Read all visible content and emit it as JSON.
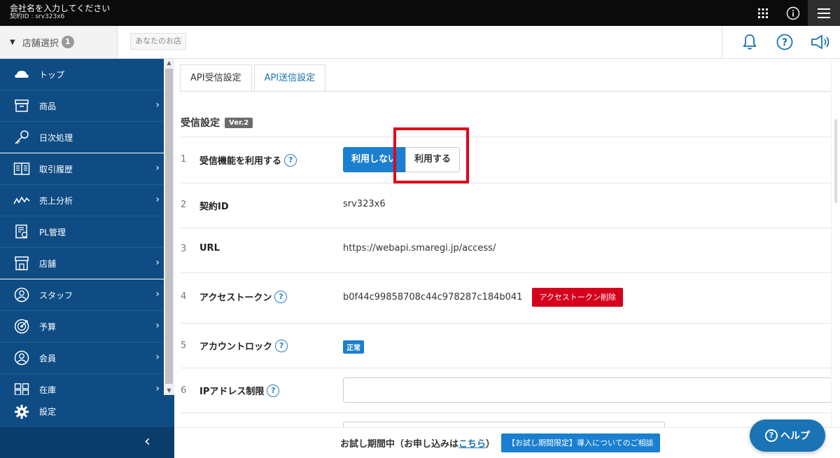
{
  "header": {
    "company_name": "会社名を入力してください",
    "contract_id": "契約ID : srv323x6",
    "icons": [
      "apps-grid-icon",
      "info-icon",
      "hamburger-menu-icon"
    ]
  },
  "storebar": {
    "store_select_label": "店舗選択",
    "store_count": "1",
    "store_chip": "あなたのお店",
    "icons": [
      "bell-icon",
      "help-circle-icon",
      "megaphone-icon"
    ]
  },
  "sidebar": {
    "items": [
      {
        "label": "トップ",
        "icon": "cloud-icon"
      },
      {
        "label": "商品",
        "icon": "box-icon"
      },
      {
        "label": "日次処理",
        "icon": "key-icon"
      },
      {
        "label": "取引履歴",
        "icon": "book-icon"
      },
      {
        "label": "売上分析",
        "icon": "chart-line-icon"
      },
      {
        "label": "PL管理",
        "icon": "pl-document-icon"
      },
      {
        "label": "店舗",
        "icon": "store-icon"
      },
      {
        "label": "スタッフ",
        "icon": "staff-icon"
      },
      {
        "label": "予算",
        "icon": "target-icon"
      },
      {
        "label": "会員",
        "icon": "member-icon"
      },
      {
        "label": "在庫",
        "icon": "inventory-icon"
      }
    ],
    "settings_label": "設定",
    "collapse_icon": "‹"
  },
  "tabs": [
    {
      "label": "API受信設定",
      "active": true
    },
    {
      "label": "API送信設定",
      "active": false
    }
  ],
  "section": {
    "title": "受信設定",
    "version": "Ver.2"
  },
  "rows": [
    {
      "num": "1",
      "label": "受信機能を利用する",
      "help": "?",
      "toggle_off": "利用しない",
      "toggle_on": "利用する"
    },
    {
      "num": "2",
      "label": "契約ID",
      "value": "srv323x6"
    },
    {
      "num": "3",
      "label": "URL",
      "value": "https://webapi.smaregi.jp/access/"
    },
    {
      "num": "4",
      "label": "アクセストークン",
      "help": "?",
      "value": "b0f44c99858708c44c978287c184b041",
      "button": "アクセストークン削除"
    },
    {
      "num": "5",
      "label": "アカウントロック",
      "help": "?",
      "status": "正常"
    },
    {
      "num": "6",
      "label": "IPアドレス制限",
      "help": "?",
      "input_value": ""
    }
  ],
  "footer": {
    "trial_text": "お試し期間中（お申し込みは",
    "trial_link": "こちら",
    "trial_text_end": "）",
    "consult_button": "【お試し期間限定】導入についてのご相談",
    "help_button": "ヘルプ",
    "help_mark": "?"
  },
  "colors": {
    "sidebar": "#0f4c84",
    "accent": "#1a7fd0",
    "danger": "#d7001c",
    "highlight": "#e2001a"
  }
}
